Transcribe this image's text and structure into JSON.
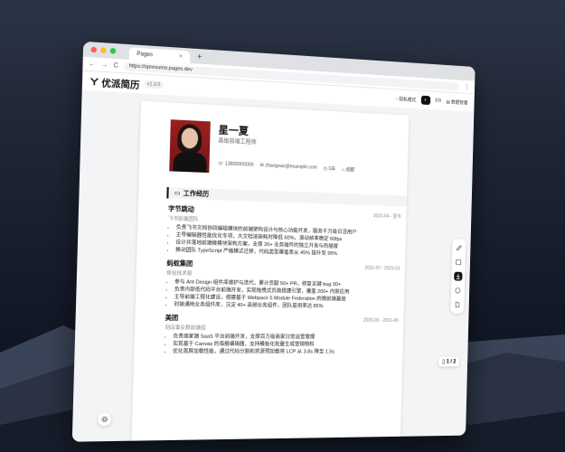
{
  "browser": {
    "tab_title": "Pages",
    "tab_close": "×",
    "new_tab": "+",
    "url": "https://opresume.pages.dev",
    "nav_back": "←",
    "nav_forward": "→",
    "nav_reload": "C",
    "menu": "⋮"
  },
  "app": {
    "logo_text": "优派简历",
    "version": "v1.3.0",
    "actions": {
      "privacy_mode": "隐私模式",
      "lang": "EN",
      "data_manage": "数据管理"
    }
  },
  "resume": {
    "name": "星一夏",
    "title": "高级前端工程师",
    "contact": {
      "phone": "13800000000",
      "email": "zhangsan@example.com",
      "years": "5年",
      "city": "成都"
    },
    "section_title": "工作经历",
    "entries": [
      {
        "company": "字节跳动",
        "date": "2023-04 - 至今",
        "dept": "飞书前端团队",
        "bullets": [
          "负责飞书文档协同编辑模块的前端架构设计与核心功能开发，服务千万级日活用户",
          "主导编辑器性能优化专项，大文档渲染耗时降低 60%，滚动帧率稳定 60fps",
          "设计并落地前端微模块架构方案，支撑 20+ 业务插件的独立开发与热插拔",
          "推动团队 TypeScript 严格模式迁移，代码类型覆盖率从 45% 提升至 95%"
        ]
      },
      {
        "company": "蚂蚁集团",
        "date": "2021-07 - 2023-03",
        "dept": "体验技术部",
        "bullets": [
          "参与 Ant Design 组件库维护与迭代，累计贡献 50+ PR，修复关键 bug 30+",
          "负责内部低代码平台前端开发，实现拖拽式页面搭建引擎，覆盖 200+ 内部应用",
          "主导前端工程化建设，搭建基于 Webpack 5 Module Federation 的微前端基座",
          "封装通用业务组件库，沉淀 40+ 高频业务组件，团队复用率达 85%"
        ]
      },
      {
        "company": "美团",
        "date": "2020-03 - 2021-06",
        "dept": "到店事业群前端组",
        "bullets": [
          "负责商家端 SaaS 平台前端开发，支撑百万级商家日常运营管理",
          "实现基于 Canvas 的海报编辑器，支持模板化批量生成营销物料",
          "优化首屏加载性能，通过代码分割和资源预加载将 LCP 从 3.8s 降至 1.5s"
        ]
      }
    ]
  },
  "pager": "1 / 2",
  "colors": {
    "accent": "#111111",
    "photo_bg": "#9a1f1f",
    "window_bg": "#f3f4f6"
  }
}
